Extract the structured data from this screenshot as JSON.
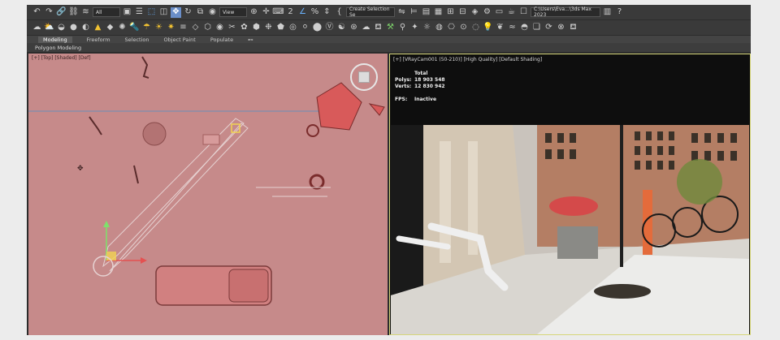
{
  "toolbar": {
    "selection_filter": "All",
    "reference_coord": "View",
    "named_selection": "Create Selection Se",
    "project_path": "C:\\Users\\Eva...\\3ds Max 2023"
  },
  "ribbon": {
    "tabs": [
      {
        "label": "Modeling",
        "active": true
      },
      {
        "label": "Freeform",
        "active": false
      },
      {
        "label": "Selection",
        "active": false
      },
      {
        "label": "Object Paint",
        "active": false
      },
      {
        "label": "Populate",
        "active": false
      }
    ],
    "sub_label": "Polygon Modeling"
  },
  "viewport_left": {
    "label": "[+] [Top] [Shaded] [Def]"
  },
  "viewport_right": {
    "label": "[+] [VRayCam001 (50-210)] [High Quality] [Default Shading]",
    "stats": {
      "total_label": "Total",
      "polys_label": "Polys:",
      "polys_value": "18 903 548",
      "verts_label": "Verts:",
      "verts_value": "12 830 942",
      "fps_label": "FPS:",
      "fps_value": "Inactive"
    }
  },
  "icons": [
    "undo-icon",
    "redo-icon",
    "link-icon",
    "unlink-icon",
    "bind-space-warp-icon",
    "select-object-icon",
    "select-by-name-icon",
    "rectangle-select-icon",
    "window-crossing-icon",
    "move-icon",
    "rotate-icon",
    "scale-icon",
    "place-icon",
    "snap-icon",
    "angle-snap-icon",
    "percent-snap-icon",
    "spinner-snap-icon",
    "mirror-icon",
    "align-icon",
    "layer-icon",
    "schematic-icon",
    "material-editor-icon",
    "render-setup-icon",
    "render-frame-icon",
    "render-icon"
  ]
}
